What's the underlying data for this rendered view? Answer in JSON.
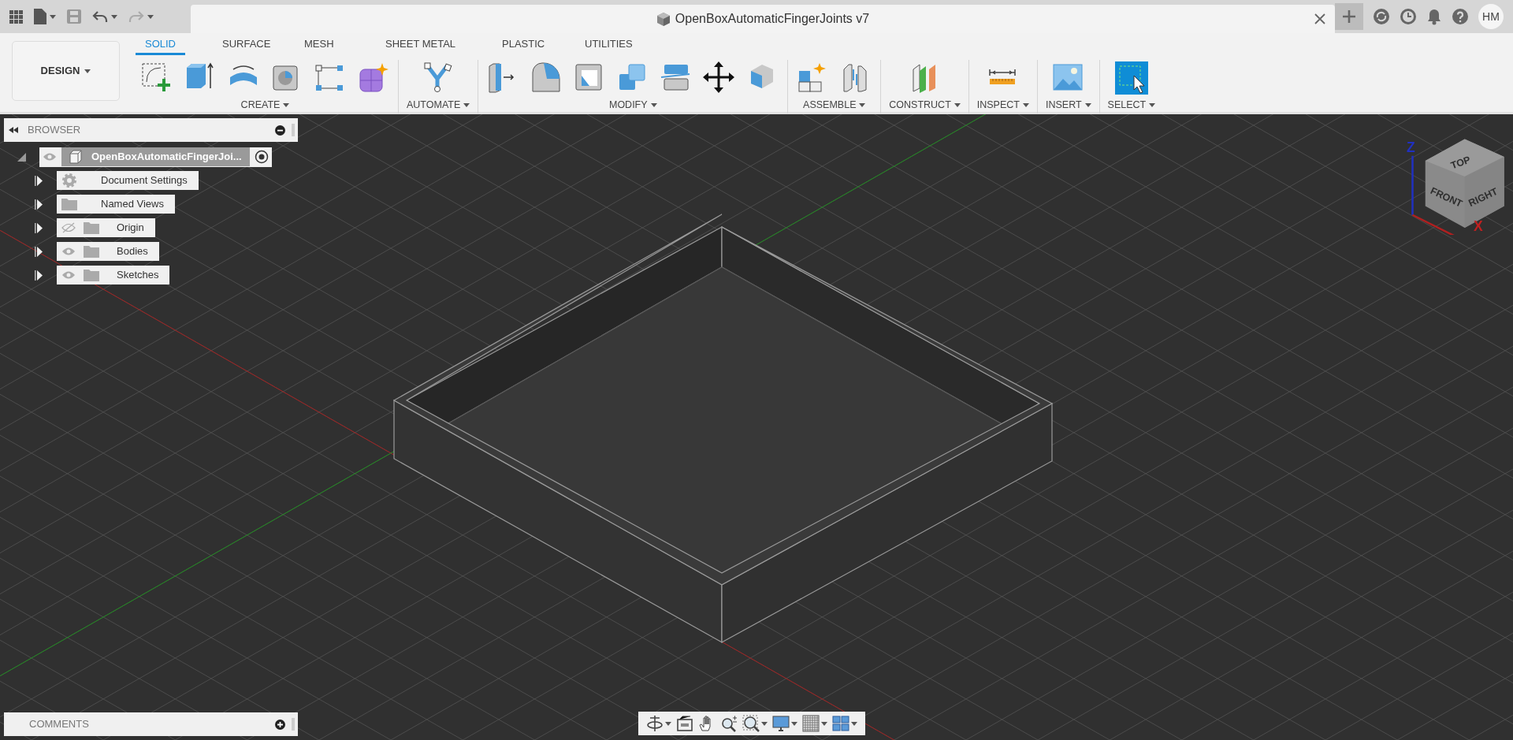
{
  "app_bar": {
    "document_title": "OpenBoxAutomaticFingerJoints v7",
    "user_initials": "HM"
  },
  "workspace": {
    "label": "DESIGN"
  },
  "tabs": [
    {
      "label": "SOLID",
      "selected": true
    },
    {
      "label": "SURFACE",
      "selected": false
    },
    {
      "label": "MESH",
      "selected": false
    },
    {
      "label": "SHEET METAL",
      "selected": false
    },
    {
      "label": "PLASTIC",
      "selected": false
    },
    {
      "label": "UTILITIES",
      "selected": false
    }
  ],
  "tool_groups": [
    {
      "label": "CREATE"
    },
    {
      "label": "AUTOMATE"
    },
    {
      "label": "MODIFY"
    },
    {
      "label": "ASSEMBLE"
    },
    {
      "label": "CONSTRUCT"
    },
    {
      "label": "INSPECT"
    },
    {
      "label": "INSERT"
    },
    {
      "label": "SELECT"
    }
  ],
  "browser": {
    "title": "BROWSER",
    "root": {
      "label": "OpenBoxAutomaticFingerJoi...",
      "visible": true,
      "expanded": true,
      "children": [
        {
          "label": "Document Settings",
          "kind": "settings",
          "expanded": false
        },
        {
          "label": "Named Views",
          "kind": "folder",
          "expanded": false
        },
        {
          "label": "Origin",
          "kind": "folder",
          "visible": false,
          "expanded": false
        },
        {
          "label": "Bodies",
          "kind": "folder",
          "visible": true,
          "expanded": false
        },
        {
          "label": "Sketches",
          "kind": "folder",
          "visible": true,
          "expanded": false
        }
      ]
    }
  },
  "viewcube": {
    "faces": [
      "TOP",
      "FRONT",
      "RIGHT"
    ],
    "axes": [
      "Z",
      "X"
    ]
  },
  "comments": {
    "title": "COMMENTS"
  }
}
